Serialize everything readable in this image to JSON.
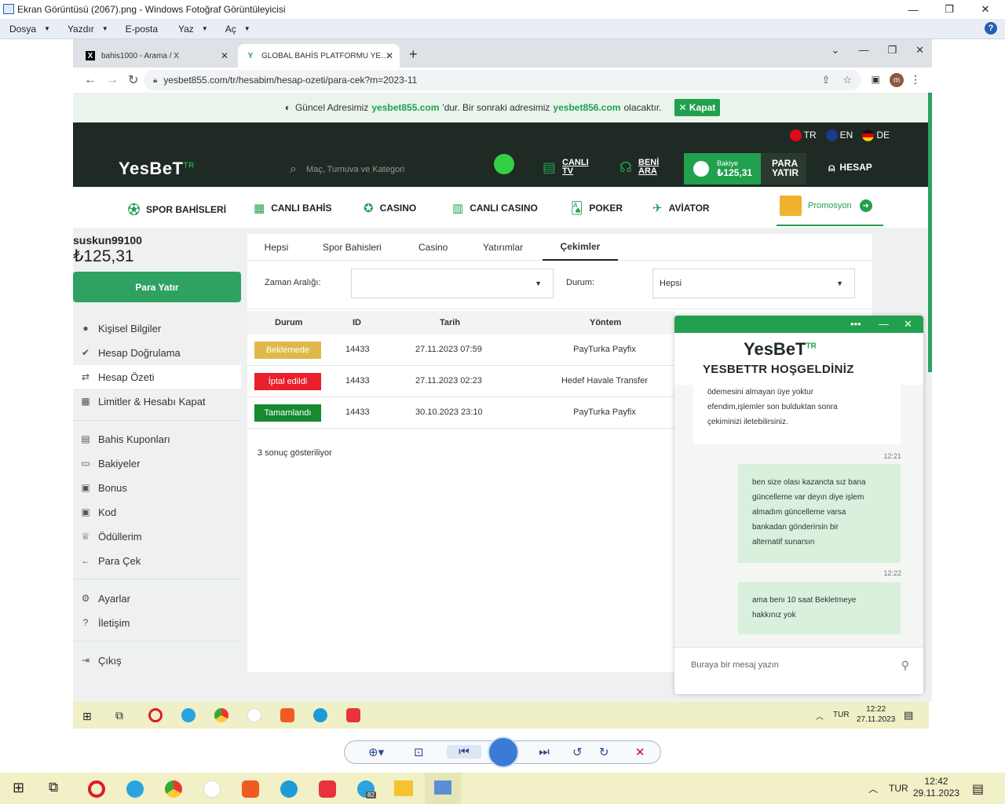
{
  "viewer": {
    "title": "Ekran Görüntüsü (2067).png - Windows Fotoğraf Görüntüleyicisi",
    "menu": [
      "Dosya",
      "Yazdır",
      "E-posta",
      "Yaz",
      "Aç"
    ]
  },
  "browser": {
    "tabs": [
      {
        "label": "bahis1000 - Arama / X",
        "favicon": "X"
      },
      {
        "label": "GLOBAL BAHİS PLATFORMU YE…",
        "favicon": "Y"
      }
    ],
    "url": "yesbet855.com/tr/hesabim/hesap-ozeti/para-cek?m=2023-11",
    "profile_initial": "m"
  },
  "notice": {
    "prefix": "Güncel Adresimiz",
    "current": "yesbet855.com",
    "middle": "'dur. Bir sonraki adresimiz",
    "next": "yesbet856.com",
    "suffix": "olacaktır.",
    "close": "Kapat"
  },
  "header": {
    "languages": [
      "TR",
      "EN",
      "DE"
    ],
    "logo": "YesBeT",
    "logo_sup": "TR",
    "search_placeholder": "Maç, Turnuva ve Kategori",
    "canli_tv": [
      "CANLI",
      "TV"
    ],
    "beni_ara": [
      "BENİ",
      "ARA"
    ],
    "bakiye_label": "Bakiye",
    "bakiye_value": "₺125,31",
    "para_yatir": [
      "PARA",
      "YATIR"
    ],
    "hesap": "HESAP"
  },
  "nav": {
    "items": [
      "SPOR BAHİSLERİ",
      "CANLI BAHİS",
      "CASINO",
      "CANLI CASINO",
      "POKER",
      "AVİATOR"
    ],
    "promo": "Promosyon"
  },
  "sidebar": {
    "username": "suskun99100",
    "balance": "₺125,31",
    "deposit": "Para Yatır",
    "group1": [
      "Kişisel Bilgiler",
      "Hesap Doğrulama",
      "Hesap Özeti",
      "Limitler & Hesabı Kapat"
    ],
    "group2": [
      "Bahis Kuponları",
      "Bakiyeler",
      "Bonus",
      "Kod",
      "Ödüllerim",
      "Para Çek"
    ],
    "group3": [
      "Ayarlar",
      "İletişim"
    ],
    "logout": "Çıkış"
  },
  "content": {
    "tabs": [
      "Hepsi",
      "Spor Bahisleri",
      "Casino",
      "Yatırımlar",
      "Çekimler"
    ],
    "active_tab": "Çekimler",
    "date_label": "Zaman Aralığı:",
    "date_value": "",
    "status_label": "Durum:",
    "status_value": "Hepsi",
    "columns": [
      "Durum",
      "ID",
      "Tarih",
      "Yöntem"
    ],
    "rows": [
      {
        "status": "Beklemede",
        "color": "#e0b84a",
        "id": "14433",
        "date": "27.11.2023 07:59",
        "method": "PayTurka Payfix"
      },
      {
        "status": "İptal edildi",
        "color": "#e8202a",
        "id": "14433",
        "date": "27.11.2023 02:23",
        "method": "Hedef Havale Transfer"
      },
      {
        "status": "Tamamlandı",
        "color": "#178a2f",
        "id": "14433",
        "date": "30.10.2023 23:10",
        "method": "PayTurka Payfix"
      }
    ],
    "results": "3 sonuç gösteriliyor"
  },
  "chat": {
    "logo": "YesBeT",
    "logo_sup": "TR",
    "welcome": "YESBETTR HOŞGELDİNİZ",
    "msg1": [
      "ödemesini almayan üye yoktur",
      "efendim,işlemler son bulduktan sonra",
      "çekiminizi iletebilirsiniz."
    ],
    "time1": "12:21",
    "msg2": [
      "ben size olası kazancta sız bana",
      "güncelleme var deyın diye işlem",
      "almadım güncelleme varsa",
      "bankadan gönderirsin bir",
      "alternatif sunarsın"
    ],
    "time2": "12:22",
    "msg3": [
      "ama benı 10 saat Bekletmeye",
      "hakkınız yok"
    ],
    "input_placeholder": "Buraya bir mesaj yazın"
  },
  "inner_taskbar": {
    "lang": "TUR",
    "time": "12:22",
    "date": "27.11.2023"
  },
  "taskbar": {
    "lang": "TUR",
    "time": "12:42",
    "date": "29.11.2023",
    "badge": "82"
  },
  "colors": {
    "brand_green": "#21a04e",
    "header_dark": "#1e2a23"
  }
}
